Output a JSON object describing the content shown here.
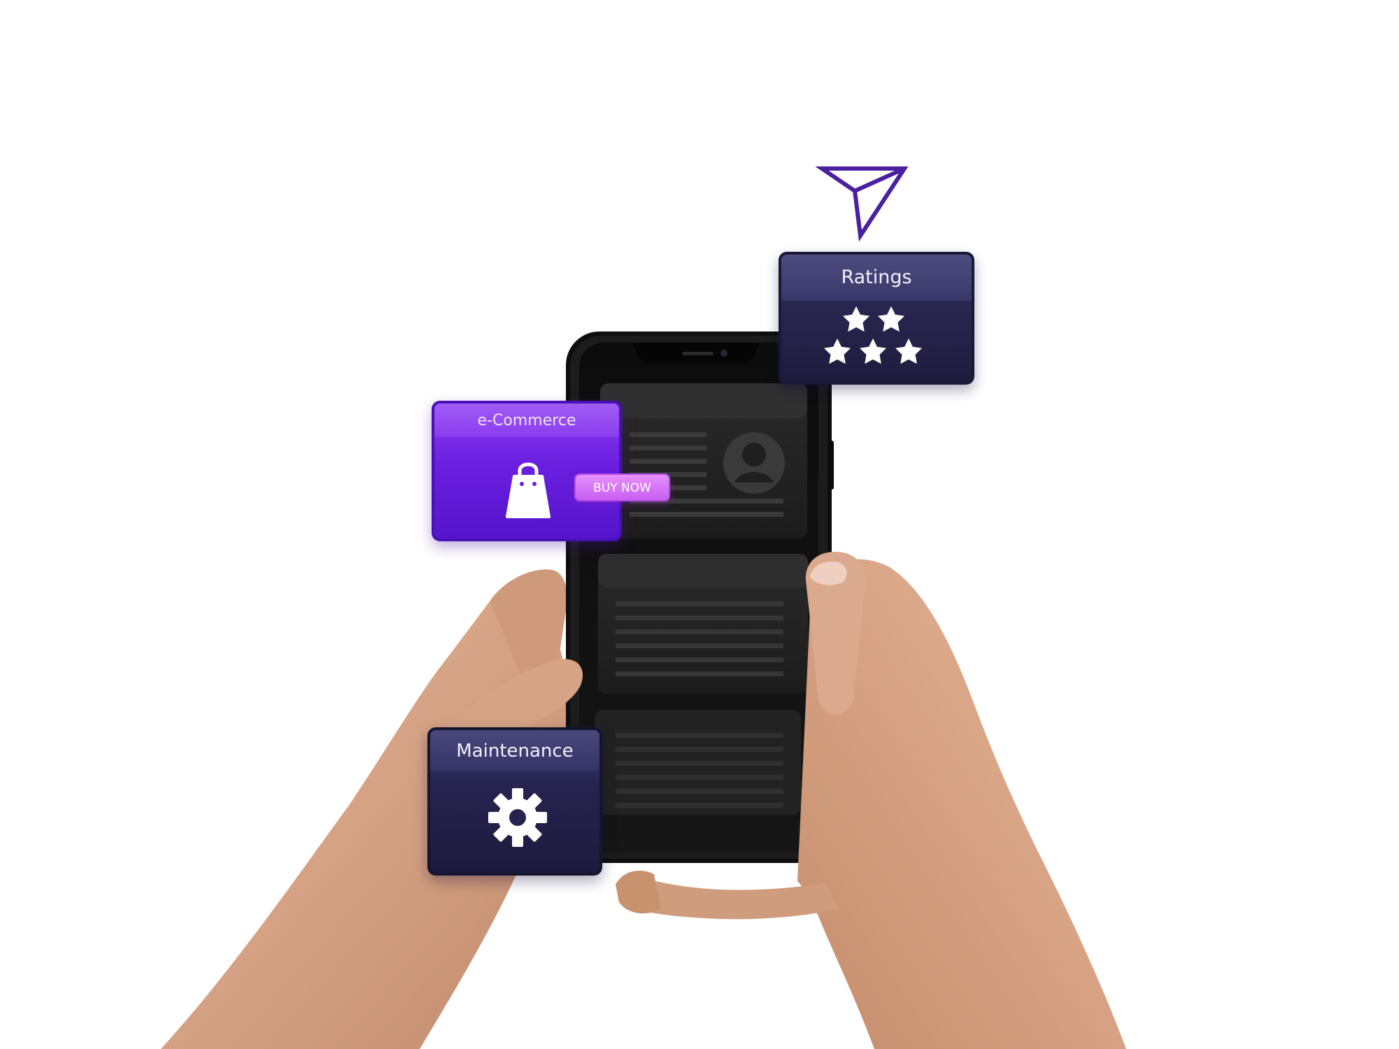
{
  "cards": {
    "ratings": {
      "title": "Ratings",
      "icon": "star-icon",
      "star_count": 5
    },
    "ecommerce": {
      "title": "e-Commerce",
      "icon": "shopping-bag-icon",
      "button_label": "BUY NOW"
    },
    "maintenance": {
      "title": "Maintenance",
      "icon": "gear-icon"
    }
  },
  "decoration": {
    "icon": "send-arrow-icon"
  },
  "colors": {
    "accent_purple": "#6a1fe0",
    "navy_card": "#26244f",
    "button_pink": "#d473f5",
    "phone_body": "#141414",
    "skin": "#d9a486"
  }
}
